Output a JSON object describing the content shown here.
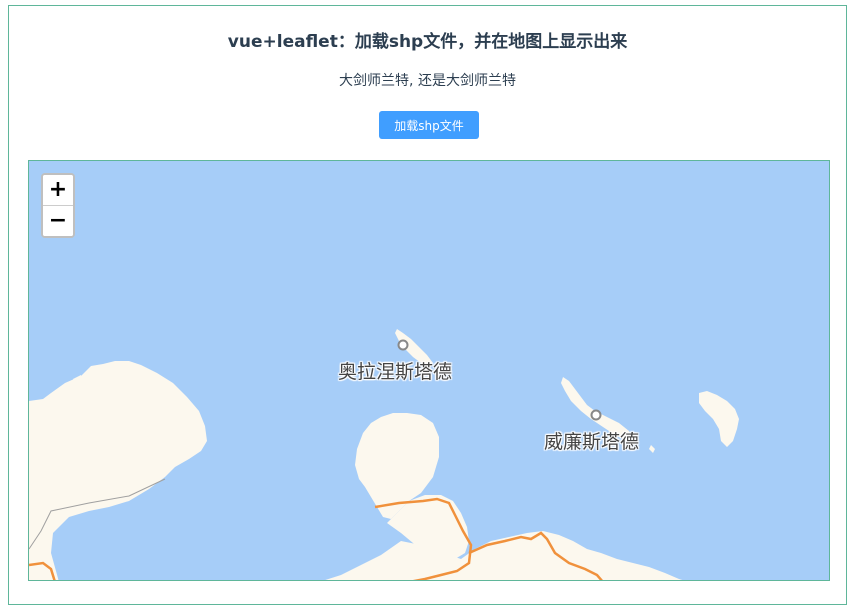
{
  "header": {
    "title": "vue+leaflet：加载shp文件，并在地图上显示出来",
    "subtitle": "大剑师兰特, 还是大剑师兰特"
  },
  "toolbar": {
    "load_shp_label": "加载shp文件"
  },
  "map": {
    "zoom_in_label": "+",
    "zoom_out_label": "−",
    "places": [
      {
        "name": "奥拉涅斯塔德"
      },
      {
        "name": "威廉斯塔德"
      }
    ],
    "colors": {
      "water": "#a6cdf8",
      "land": "#fcf8ee",
      "road": "#f0913c",
      "accent": "#409eff",
      "border": "#5fb69a"
    }
  }
}
